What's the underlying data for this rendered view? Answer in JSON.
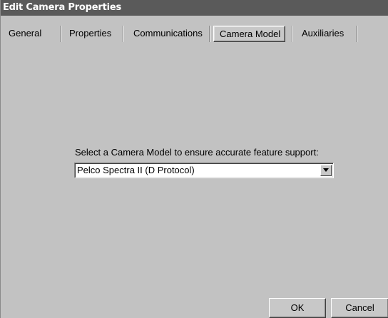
{
  "window": {
    "title": "Edit Camera Properties"
  },
  "tabs": [
    {
      "label": "General",
      "active": false
    },
    {
      "label": "Properties",
      "active": false
    },
    {
      "label": "Communications",
      "active": false
    },
    {
      "label": "Camera Model",
      "active": true
    },
    {
      "label": "Auxiliaries",
      "active": false
    }
  ],
  "camera_model": {
    "prompt": "Select a Camera Model to ensure accurate feature support:",
    "selected_value": "Pelco Spectra II  (D Protocol)",
    "dropdown_icon": "chevron-down-icon"
  },
  "buttons": {
    "ok_label": "OK",
    "cancel_label": "Cancel"
  },
  "colors": {
    "title_bar": "#5a5a5a",
    "background": "#c2c2c2"
  }
}
